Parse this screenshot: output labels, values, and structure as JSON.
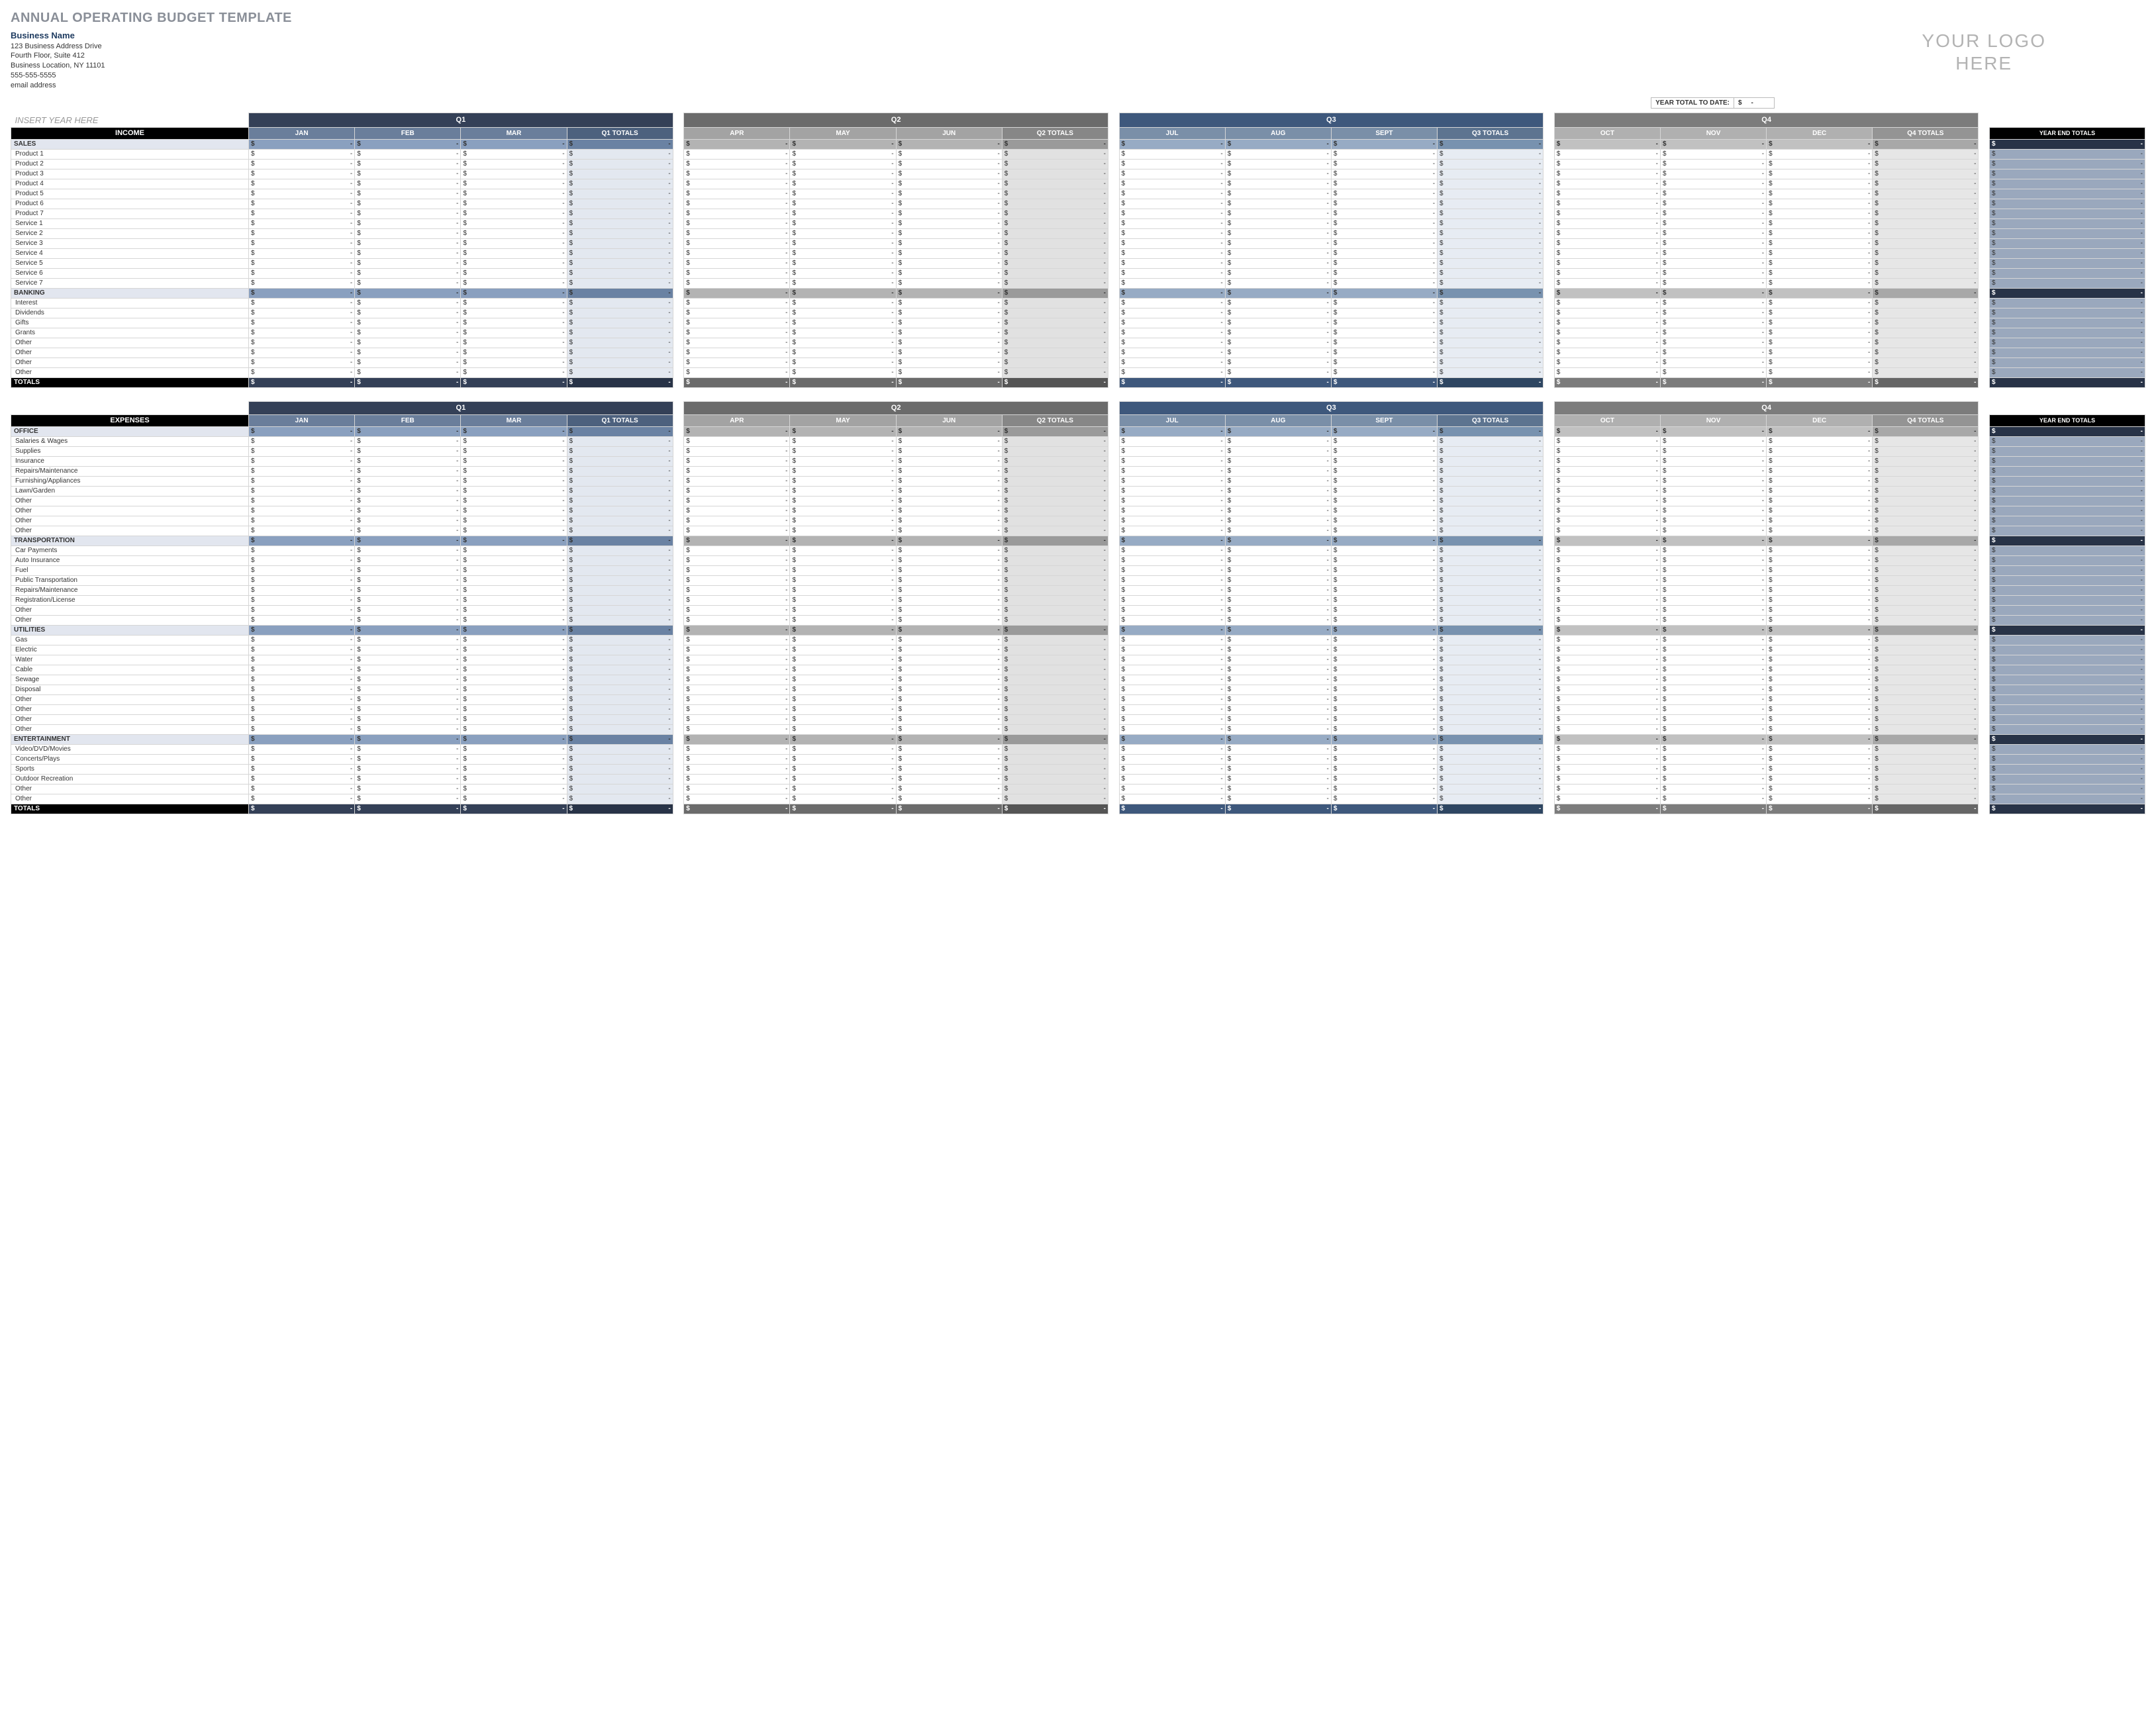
{
  "title": "ANNUAL OPERATING BUDGET TEMPLATE",
  "business": {
    "name": "Business Name",
    "addr1": "123 Business Address Drive",
    "addr2": "Fourth Floor, Suite 412",
    "addr3": "Business Location, NY 11101",
    "phone": "555-555-5555",
    "email": "email address"
  },
  "logo": {
    "line1": "YOUR LOGO",
    "line2": "HERE"
  },
  "ytd": {
    "label": "YEAR TOTAL TO DATE:",
    "value_sym": "$",
    "value_dash": "-"
  },
  "year_placeholder": "INSERT YEAR HERE",
  "quarters": [
    "Q1",
    "Q2",
    "Q3",
    "Q4"
  ],
  "months": {
    "q1": [
      "JAN",
      "FEB",
      "MAR"
    ],
    "q1t": "Q1 TOTALS",
    "q2": [
      "APR",
      "MAY",
      "JUN"
    ],
    "q2t": "Q2 TOTALS",
    "q3": [
      "JUL",
      "AUG",
      "SEPT"
    ],
    "q3t": "Q3 TOTALS",
    "q4": [
      "OCT",
      "NOV",
      "DEC"
    ],
    "q4t": "Q4 TOTALS"
  },
  "yet_label": "YEAR END TOTALS",
  "cell": {
    "sym": "$",
    "dash": "-"
  },
  "totals_label": "TOTALS",
  "sections": [
    {
      "header": "INCOME",
      "groups": [
        {
          "name": "SALES",
          "rows": [
            "Product 1",
            "Product 2",
            "Product 3",
            "Product 4",
            "Product 5",
            "Product 6",
            "Product 7",
            "Service 1",
            "Service 2",
            "Service 3",
            "Service 4",
            "Service 5",
            "Service 6",
            "Service 7"
          ]
        },
        {
          "name": "BANKING",
          "rows": [
            "Interest",
            "Dividends",
            "Gifts",
            "Grants",
            "Other",
            "Other",
            "Other",
            "Other"
          ]
        }
      ]
    },
    {
      "header": "EXPENSES",
      "groups": [
        {
          "name": "OFFICE",
          "rows": [
            "Salaries & Wages",
            "Supplies",
            "Insurance",
            "Repairs/Maintenance",
            "Furnishing/Appliances",
            "Lawn/Garden",
            "Other",
            "Other",
            "Other",
            "Other"
          ]
        },
        {
          "name": "TRANSPORTATION",
          "rows": [
            "Car Payments",
            "Auto Insurance",
            "Fuel",
            "Public Transportation",
            "Repairs/Maintenance",
            "Registration/License",
            "Other",
            "Other"
          ]
        },
        {
          "name": "UTILITIES",
          "rows": [
            "Gas",
            "Electric",
            "Water",
            "Cable",
            "Sewage",
            "Disposal",
            "Other",
            "Other",
            "Other",
            "Other"
          ]
        },
        {
          "name": "ENTERTAINMENT",
          "rows": [
            "Video/DVD/Movies",
            "Concerts/Plays",
            "Sports",
            "Outdoor Recreation",
            "Other",
            "Other"
          ]
        }
      ]
    }
  ]
}
